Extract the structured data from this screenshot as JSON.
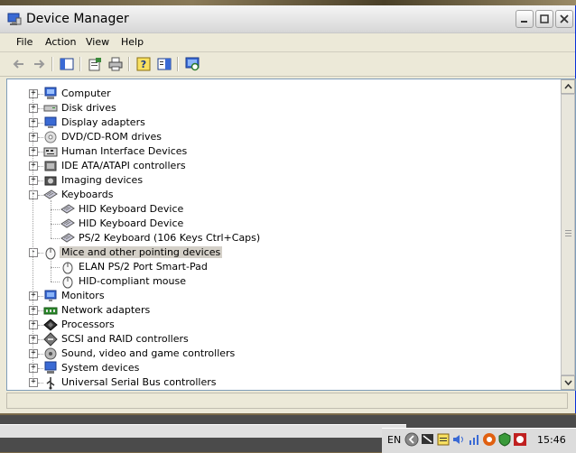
{
  "window": {
    "title": "Device Manager"
  },
  "menubar": {
    "items": [
      "File",
      "Action",
      "View",
      "Help"
    ]
  },
  "tree": {
    "items": [
      {
        "label": "Computer",
        "icon": "computer-icon",
        "expander": "+",
        "level": 0
      },
      {
        "label": "Disk drives",
        "icon": "disk-drive-icon",
        "expander": "+",
        "level": 0
      },
      {
        "label": "Display adapters",
        "icon": "display-adapter-icon",
        "expander": "+",
        "level": 0
      },
      {
        "label": "DVD/CD-ROM drives",
        "icon": "cdrom-icon",
        "expander": "+",
        "level": 0
      },
      {
        "label": "Human Interface Devices",
        "icon": "hid-icon",
        "expander": "+",
        "level": 0
      },
      {
        "label": "IDE ATA/ATAPI controllers",
        "icon": "ide-controller-icon",
        "expander": "+",
        "level": 0
      },
      {
        "label": "Imaging devices",
        "icon": "camera-icon",
        "expander": "+",
        "level": 0
      },
      {
        "label": "Keyboards",
        "icon": "keyboard-icon",
        "expander": "-",
        "level": 0
      },
      {
        "label": "HID Keyboard Device",
        "icon": "keyboard-icon",
        "expander": "",
        "level": 1
      },
      {
        "label": "HID Keyboard Device",
        "icon": "keyboard-icon",
        "expander": "",
        "level": 1
      },
      {
        "label": "PS/2 Keyboard (106 Keys Ctrl+Caps)",
        "icon": "keyboard-icon",
        "expander": "",
        "level": 1
      },
      {
        "label": "Mice and other pointing devices",
        "icon": "mouse-icon",
        "expander": "-",
        "level": 0,
        "selected": true
      },
      {
        "label": "ELAN PS/2 Port Smart-Pad",
        "icon": "mouse-icon",
        "expander": "",
        "level": 1
      },
      {
        "label": "HID-compliant mouse",
        "icon": "mouse-icon",
        "expander": "",
        "level": 1
      },
      {
        "label": "Monitors",
        "icon": "monitor-icon",
        "expander": "+",
        "level": 0
      },
      {
        "label": "Network adapters",
        "icon": "network-adapter-icon",
        "expander": "+",
        "level": 0
      },
      {
        "label": "Processors",
        "icon": "processor-icon",
        "expander": "+",
        "level": 0
      },
      {
        "label": "SCSI and RAID controllers",
        "icon": "scsi-icon",
        "expander": "+",
        "level": 0
      },
      {
        "label": "Sound, video and game controllers",
        "icon": "sound-icon",
        "expander": "+",
        "level": 0
      },
      {
        "label": "System devices",
        "icon": "system-device-icon",
        "expander": "+",
        "level": 0
      },
      {
        "label": "Universal Serial Bus controllers",
        "icon": "usb-icon",
        "expander": "+",
        "level": 0
      }
    ]
  },
  "taskbar": {
    "language": "EN",
    "clock": "15:46"
  },
  "colors": {
    "selection": "#d4d0c8",
    "panel_border": "#7f9db9"
  }
}
